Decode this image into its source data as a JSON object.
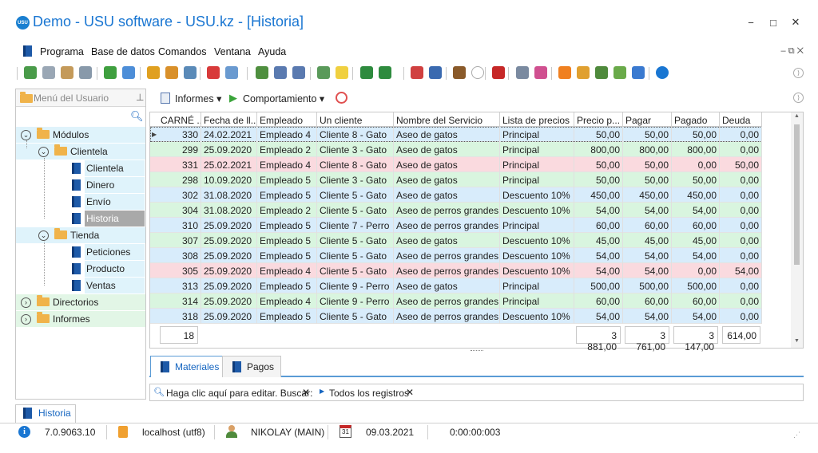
{
  "window": {
    "logo_text": "USU",
    "title": "Demo - USU software - USU.kz - [Historia]",
    "minimize": "−",
    "maximize": "□",
    "close": "✕"
  },
  "menu": {
    "items": [
      "Programa",
      "Base de datos",
      "Comandos",
      "Ventana",
      "Ayuda"
    ],
    "mdi_controls": "–  ⧉  ✕"
  },
  "sidebar": {
    "title": "Menú del Usuario",
    "tree": [
      {
        "label": "Módulos",
        "level": 0,
        "kind": "folder",
        "expanded": true
      },
      {
        "label": "Clientela",
        "level": 1,
        "kind": "folder",
        "expanded": true
      },
      {
        "label": "Clientela",
        "level": 2,
        "kind": "doc"
      },
      {
        "label": "Dinero",
        "level": 2,
        "kind": "doc"
      },
      {
        "label": "Envío",
        "level": 2,
        "kind": "doc"
      },
      {
        "label": "Historia",
        "level": 2,
        "kind": "doc",
        "selected": true
      },
      {
        "label": "Tienda",
        "level": 1,
        "kind": "folder",
        "expanded": true
      },
      {
        "label": "Peticiones",
        "level": 2,
        "kind": "doc"
      },
      {
        "label": "Producto",
        "level": 2,
        "kind": "doc"
      },
      {
        "label": "Ventas",
        "level": 2,
        "kind": "doc"
      },
      {
        "label": "Directorios",
        "level": 0,
        "kind": "folder",
        "expanded": false
      },
      {
        "label": "Informes",
        "level": 0,
        "kind": "folder",
        "expanded": false
      }
    ]
  },
  "content_toolbar": {
    "reports_label": "Informes",
    "behavior_label": "Comportamiento"
  },
  "grid": {
    "columns": [
      "CARNÉ ...",
      "Fecha de ll...",
      "Empleado",
      "Un cliente",
      "Nombre del Servicio",
      "Lista de precios",
      "Precio p...",
      "Pagar",
      "Pagado",
      "Deuda"
    ],
    "rows": [
      {
        "color": "#d8ecfb",
        "cells": [
          "330",
          "24.02.2021",
          "Empleado 4",
          "Cliente 8 - Gato",
          "Aseo de gatos",
          "Principal",
          "50,00",
          "50,00",
          "50,00",
          "0,00"
        ]
      },
      {
        "color": "#d9f5df",
        "cells": [
          "299",
          "25.09.2020",
          "Empleado 2",
          "Cliente 3 - Gato",
          "Aseo de gatos",
          "Principal",
          "800,00",
          "800,00",
          "800,00",
          "0,00"
        ]
      },
      {
        "color": "#fadadf",
        "cells": [
          "331",
          "25.02.2021",
          "Empleado 4",
          "Cliente 8 - Gato",
          "Aseo de gatos",
          "Principal",
          "50,00",
          "50,00",
          "0,00",
          "50,00"
        ]
      },
      {
        "color": "#d9f5df",
        "cells": [
          "298",
          "10.09.2020",
          "Empleado 5",
          "Cliente 3 - Gato",
          "Aseo de gatos",
          "Principal",
          "50,00",
          "50,00",
          "50,00",
          "0,00"
        ]
      },
      {
        "color": "#d8ecfb",
        "cells": [
          "302",
          "31.08.2020",
          "Empleado 5",
          "Cliente 5 - Gato",
          "Aseo de gatos",
          "Descuento 10%",
          "450,00",
          "450,00",
          "450,00",
          "0,00"
        ]
      },
      {
        "color": "#d9f5df",
        "cells": [
          "304",
          "31.08.2020",
          "Empleado 2",
          "Cliente 5 - Gato",
          "Aseo de perros grandes",
          "Descuento 10%",
          "54,00",
          "54,00",
          "54,00",
          "0,00"
        ]
      },
      {
        "color": "#d8ecfb",
        "cells": [
          "310",
          "25.09.2020",
          "Empleado 5",
          "Cliente 7 - Perro",
          "Aseo de perros grandes",
          "Principal",
          "60,00",
          "60,00",
          "60,00",
          "0,00"
        ]
      },
      {
        "color": "#d9f5df",
        "cells": [
          "307",
          "25.09.2020",
          "Empleado 5",
          "Cliente 5 - Gato",
          "Aseo de gatos",
          "Descuento 10%",
          "45,00",
          "45,00",
          "45,00",
          "0,00"
        ]
      },
      {
        "color": "#d8ecfb",
        "cells": [
          "308",
          "25.09.2020",
          "Empleado 5",
          "Cliente 5 - Gato",
          "Aseo de perros grandes",
          "Descuento 10%",
          "54,00",
          "54,00",
          "54,00",
          "0,00"
        ]
      },
      {
        "color": "#fadadf",
        "cells": [
          "305",
          "25.09.2020",
          "Empleado 4",
          "Cliente 5 - Gato",
          "Aseo de perros grandes",
          "Descuento 10%",
          "54,00",
          "54,00",
          "0,00",
          "54,00"
        ]
      },
      {
        "color": "#d8ecfb",
        "cells": [
          "313",
          "25.09.2020",
          "Empleado 5",
          "Cliente 9 - Perro",
          "Aseo de gatos",
          "Principal",
          "500,00",
          "500,00",
          "500,00",
          "0,00"
        ]
      },
      {
        "color": "#d9f5df",
        "cells": [
          "314",
          "25.09.2020",
          "Empleado 4",
          "Cliente 9 - Perro",
          "Aseo de perros grandes",
          "Principal",
          "60,00",
          "60,00",
          "60,00",
          "0,00"
        ]
      },
      {
        "color": "#d8ecfb",
        "cells": [
          "318",
          "25.09.2020",
          "Empleado 5",
          "Cliente 5 - Gato",
          "Aseo de perros grandes",
          "Descuento 10%",
          "54,00",
          "54,00",
          "54,00",
          "0,00"
        ]
      }
    ],
    "footer": {
      "count": "18",
      "precio": "3 881,00",
      "pagar": "3 761,00",
      "pagado": "3 147,00",
      "deuda": "614,00"
    }
  },
  "subtabs": [
    "Materiales",
    "Pagos"
  ],
  "filter": {
    "edit_hint": "Haga clic aquí para editar. Buscar:",
    "records": "Todos los registros"
  },
  "bottom_tab": "Historia",
  "status": {
    "version": "7.0.9063.10",
    "server": "localhost (utf8)",
    "user": "NIKOLAY (MAIN)",
    "date": "09.03.2021",
    "timer": "0:00:00:003",
    "calendar_day": "31"
  },
  "colors": {
    "accent": "#1976d2",
    "row_blue": "#d8ecfb",
    "row_green": "#d9f5df",
    "row_pink": "#fadadf"
  }
}
